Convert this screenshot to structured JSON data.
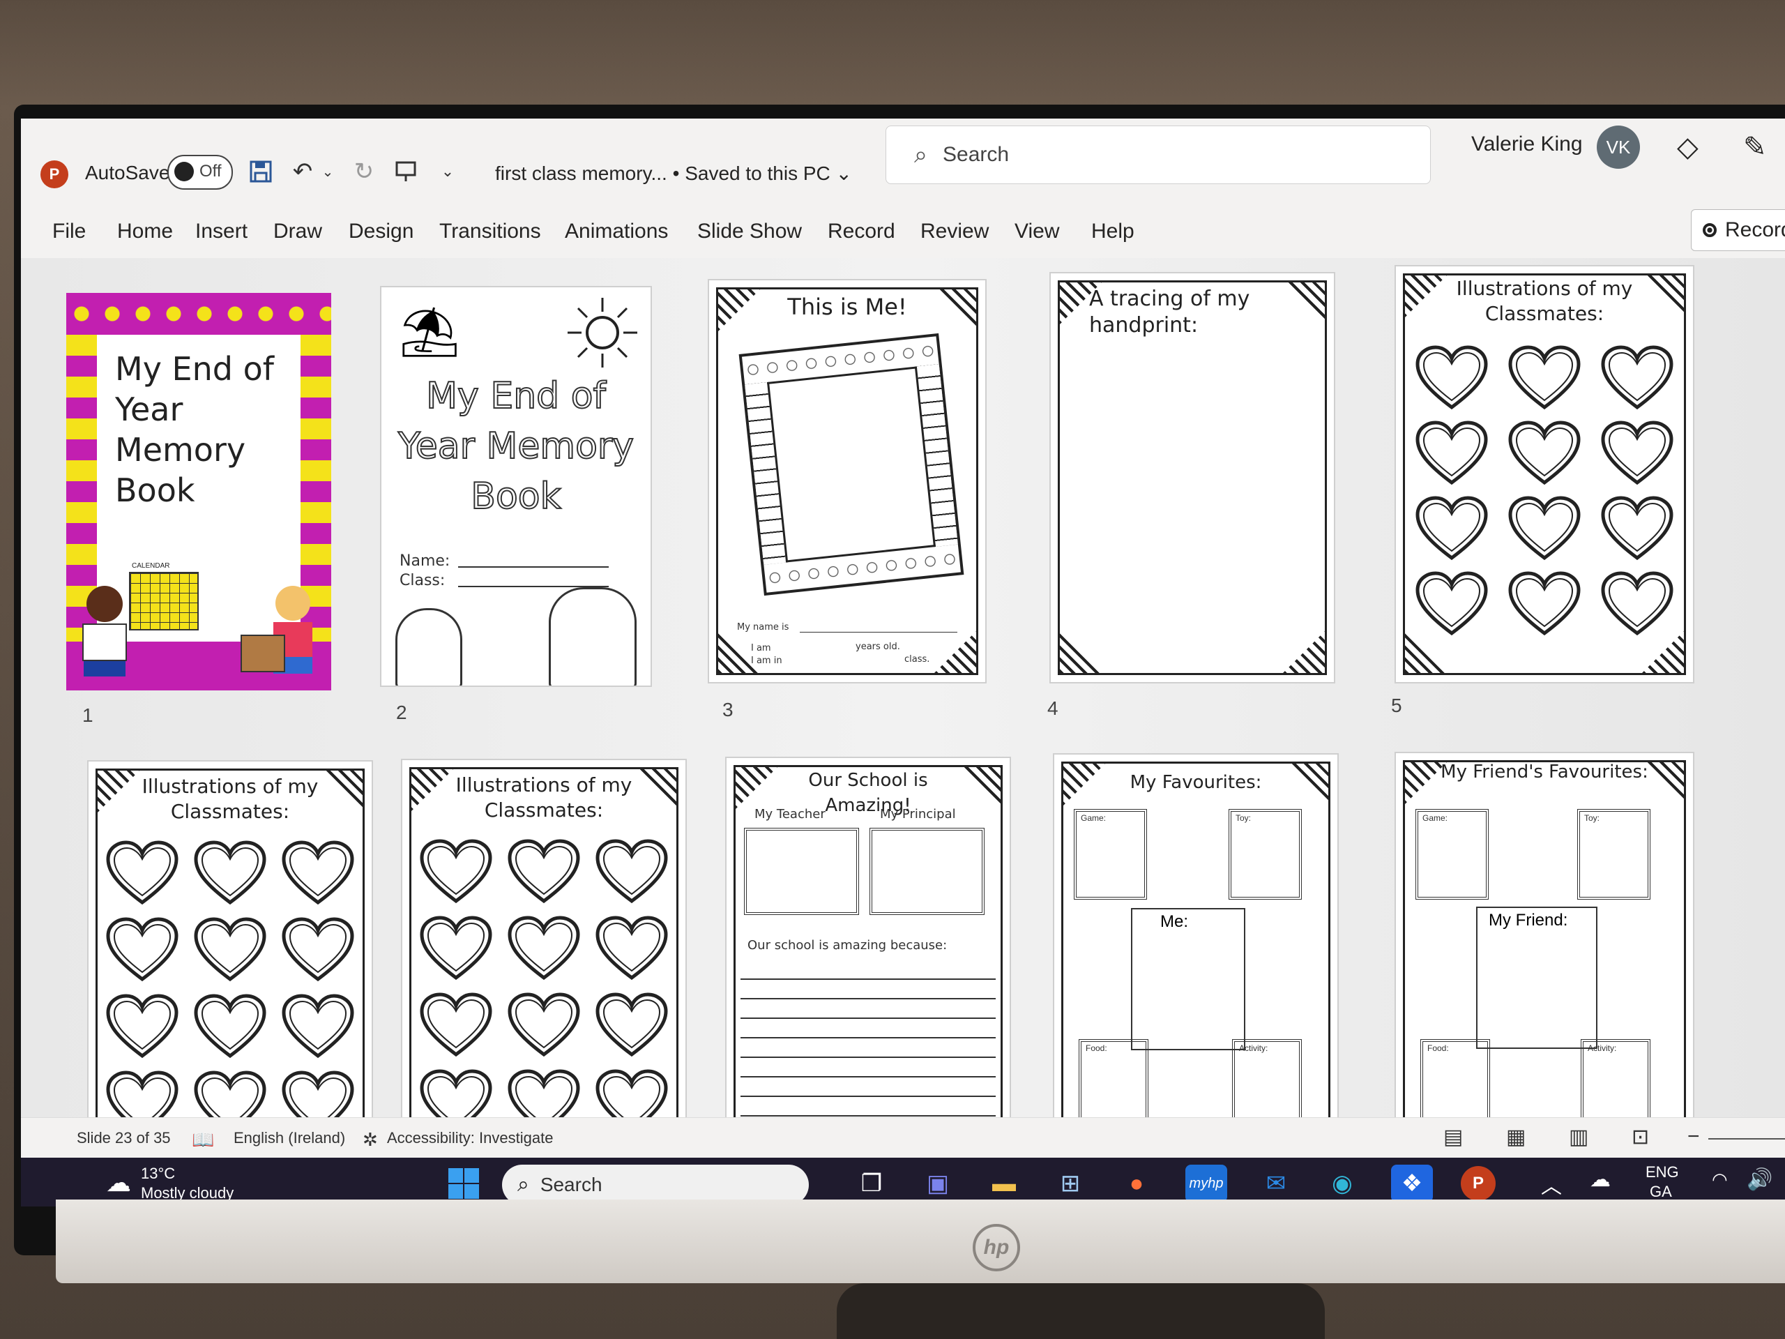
{
  "titlebar": {
    "app_icon": "P",
    "autosave_label": "AutoSave",
    "autosave_state": "Off",
    "doc_title": "first class memory...  • Saved to this PC ⌄",
    "search_placeholder": "Search",
    "user_name": "Valerie King",
    "user_initials": "VK"
  },
  "ribbon": {
    "tabs": [
      "File",
      "Home",
      "Insert",
      "Draw",
      "Design",
      "Transitions",
      "Animations",
      "Slide Show",
      "Record",
      "Review",
      "View",
      "Help"
    ],
    "record_button": "Record"
  },
  "slides": [
    {
      "num": "1",
      "title": "My End of Year Memory Book",
      "calendar_label": "CALENDAR"
    },
    {
      "num": "2",
      "title": "My End of Year Memory Book",
      "name_label": "Name:",
      "class_label": "Class:"
    },
    {
      "num": "3",
      "title": "This is Me!",
      "name_line": "My name is",
      "age_line": "I am",
      "age_suffix": "years old.",
      "class_line": "I am in",
      "class_suffix": "class."
    },
    {
      "num": "4",
      "title": "A tracing of my handprint:"
    },
    {
      "num": "5",
      "title": "Illustrations of my Classmates:"
    },
    {
      "title": "Illustrations of my Classmates:"
    },
    {
      "title": "Illustrations of my Classmates:"
    },
    {
      "title": "Our School is Amazing!",
      "teacher": "My Teacher",
      "principal": "My Principal",
      "because": "Our school is amazing because:"
    },
    {
      "title": "My Favourites:",
      "game": "Game:",
      "toy": "Toy:",
      "me": "Me:",
      "food": "Food:",
      "activity": "Activity:"
    },
    {
      "title": "My Friend's Favourites:",
      "game": "Game:",
      "toy": "Toy:",
      "friend": "My Friend:",
      "food": "Food:",
      "activity": "Activity:"
    }
  ],
  "statusbar": {
    "slide_count": "Slide 23 of 35",
    "language": "English (Ireland)",
    "accessibility": "Accessibility: Investigate"
  },
  "taskbar": {
    "weather_temp": "13°C",
    "weather_desc": "Mostly cloudy",
    "search_placeholder": "Search",
    "lang_top": "ENG",
    "lang_bottom": "GA",
    "myhp_label": "myhp"
  },
  "bezel": {
    "logo": "hp"
  },
  "colors": {
    "powerpoint": "#c43e1c",
    "taskbar": "#1f1b2e",
    "magenta": "#c21fb0",
    "yellow": "#f4e21a"
  }
}
